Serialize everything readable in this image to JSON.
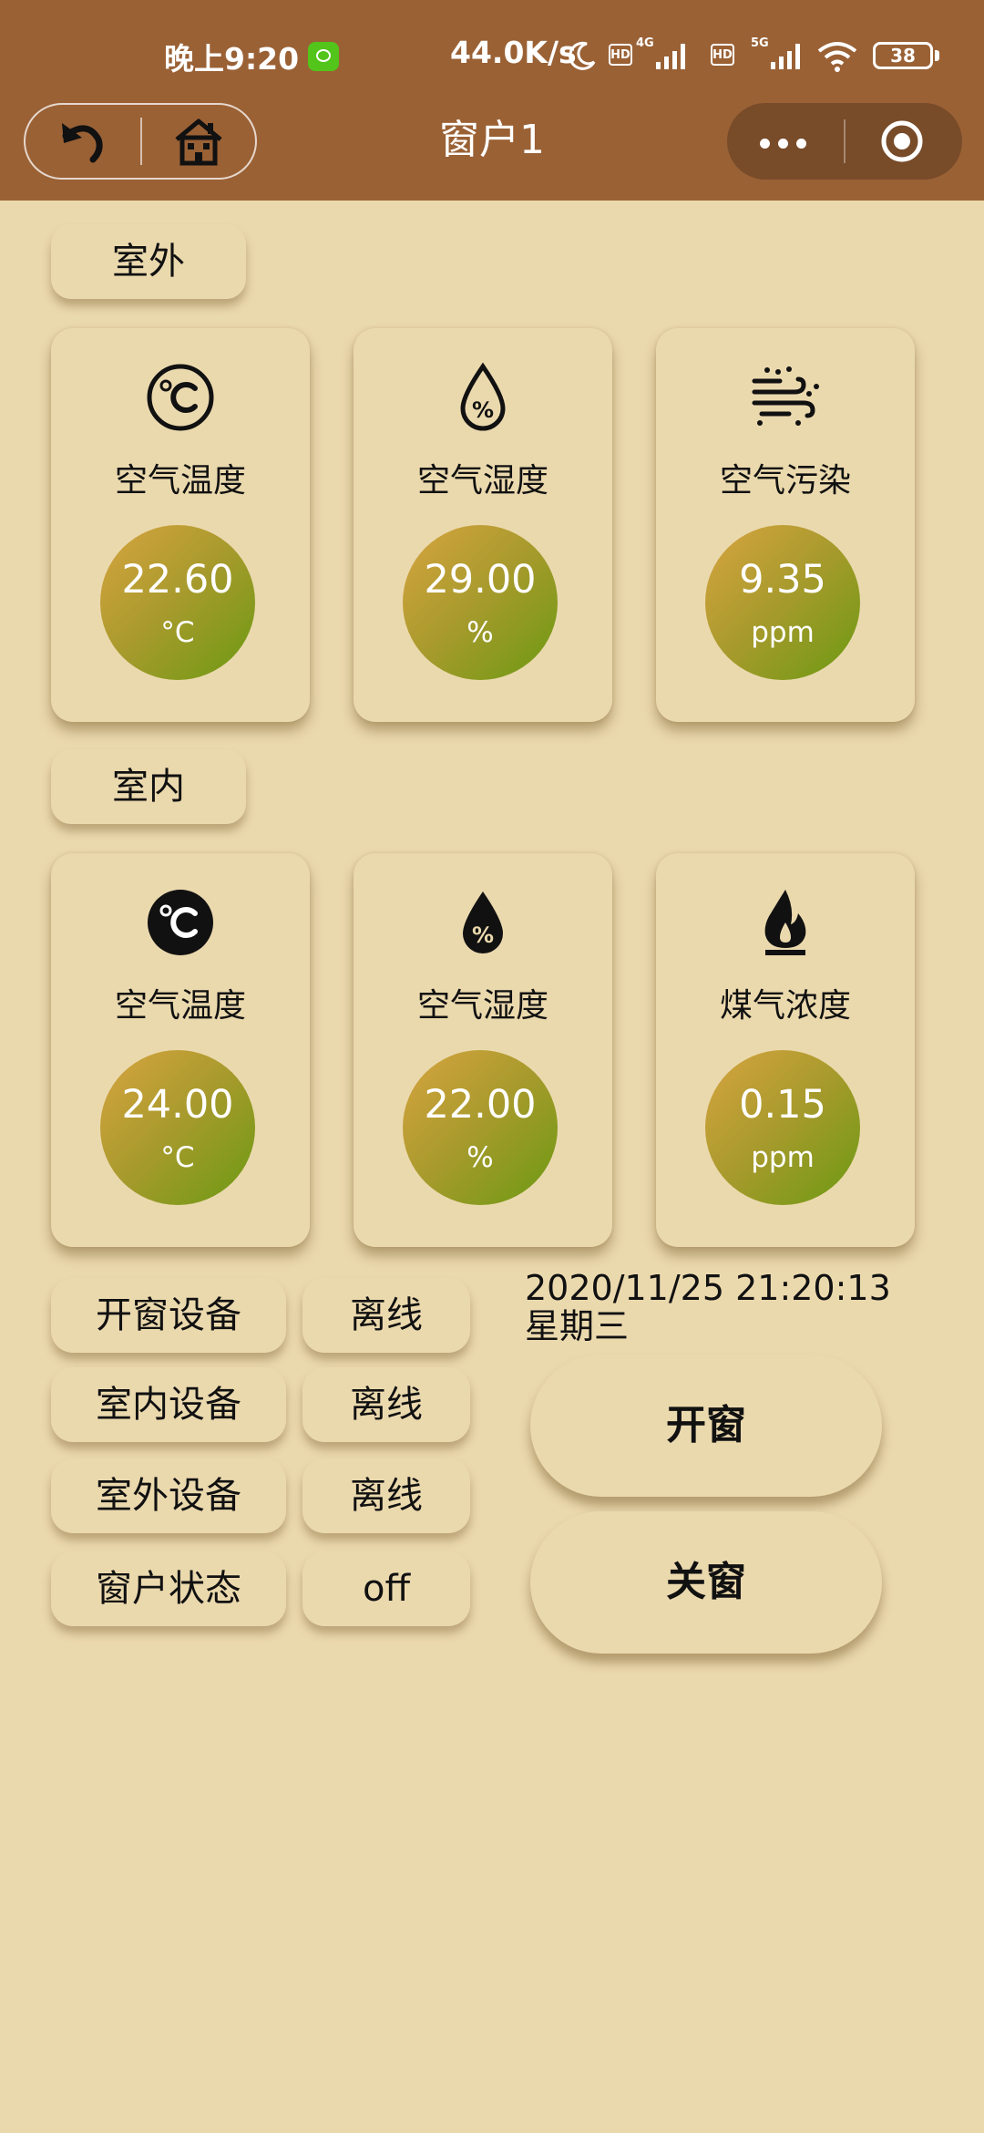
{
  "status_bar": {
    "time": "晚上9:20",
    "net_speed": "44.0K/s",
    "hd1": "HD",
    "net1": "4G",
    "hd2": "HD",
    "net2": "5G",
    "battery": "38"
  },
  "nav": {
    "title": "窗户1"
  },
  "outdoor": {
    "label": "室外",
    "cards": [
      {
        "icon": "thermometer-celsius-icon",
        "label": "空气温度",
        "value": "22.60",
        "unit": "°C"
      },
      {
        "icon": "humidity-drop-icon",
        "label": "空气湿度",
        "value": "29.00",
        "unit": "%"
      },
      {
        "icon": "air-pollution-icon",
        "label": "空气污染",
        "value": "9.35",
        "unit": "ppm"
      }
    ]
  },
  "indoor": {
    "label": "室内",
    "cards": [
      {
        "icon": "thermometer-celsius-icon",
        "label": "空气温度",
        "value": "24.00",
        "unit": "°C"
      },
      {
        "icon": "humidity-drop-icon",
        "label": "空气湿度",
        "value": "22.00",
        "unit": "%"
      },
      {
        "icon": "gas-flame-icon",
        "label": "煤气浓度",
        "value": "0.15",
        "unit": "ppm"
      }
    ]
  },
  "devices": [
    {
      "label": "开窗设备",
      "value": "离线"
    },
    {
      "label": "室内设备",
      "value": "离线"
    },
    {
      "label": "室外设备",
      "value": "离线"
    },
    {
      "label": "窗户状态",
      "value": "off"
    }
  ],
  "datetime": "2020/11/25 21:20:13",
  "weekday": "星期三",
  "actions": {
    "open": "开窗",
    "close": "关窗"
  },
  "colors": {
    "header": "#9a6135",
    "background": "#ebd9ae",
    "gauge_start": "#d8a440",
    "gauge_end": "#6b9a12"
  }
}
